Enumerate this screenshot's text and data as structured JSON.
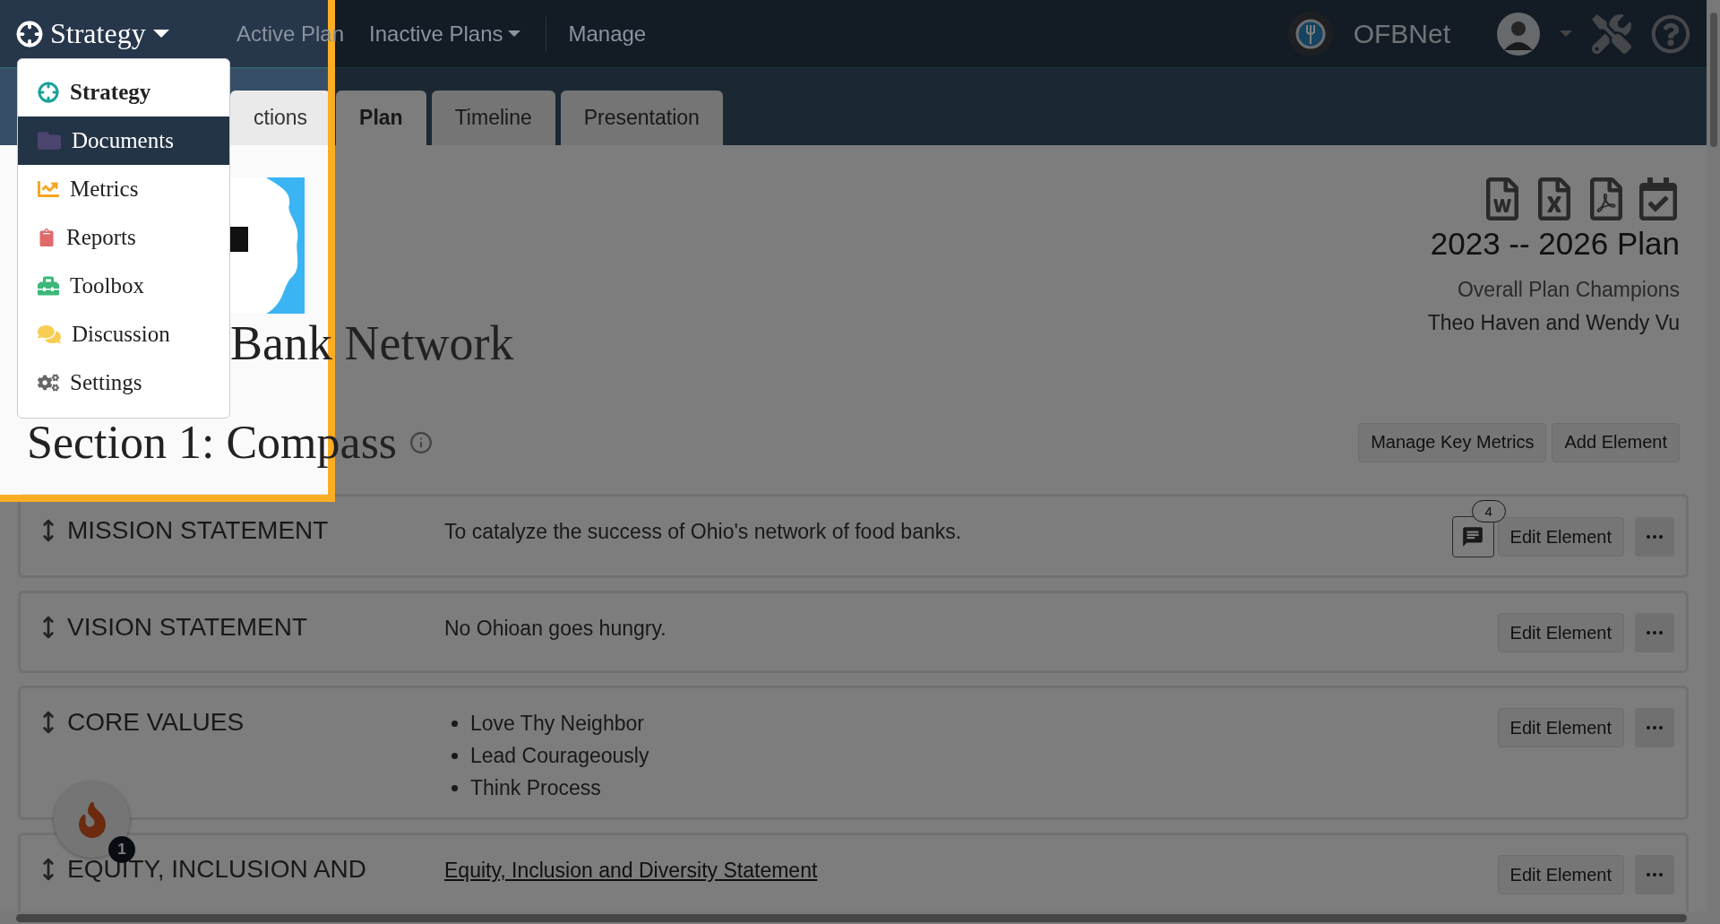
{
  "navbar": {
    "brand": "Strategy",
    "links": [
      {
        "label": "Active Plan",
        "dropdown": false
      },
      {
        "label": "Inactive Plans",
        "dropdown": true
      },
      {
        "label": "Manage",
        "dropdown": false
      }
    ],
    "org": "OFBNet"
  },
  "brand_menu": {
    "items": [
      {
        "label": "Strategy",
        "kind": "header",
        "selected": false
      },
      {
        "label": "Documents",
        "kind": "link",
        "selected": true
      },
      {
        "label": "Metrics",
        "kind": "link",
        "selected": false
      },
      {
        "label": "Reports",
        "kind": "link",
        "selected": false
      },
      {
        "label": "Toolbox",
        "kind": "link",
        "selected": false
      },
      {
        "label": "Discussion",
        "kind": "link",
        "selected": false
      },
      {
        "label": "Settings",
        "kind": "link",
        "selected": false
      }
    ]
  },
  "tabs": [
    {
      "label": "ctions",
      "selected": false
    },
    {
      "label": "Plan",
      "selected": true
    },
    {
      "label": "Timeline",
      "selected": false
    },
    {
      "label": "Presentation",
      "selected": false
    }
  ],
  "plan": {
    "title": "Bank Network",
    "period": "2023 -- 2026 Plan",
    "champions_label": "Overall Plan Champions",
    "champions": "Theo Haven and Wendy Vu"
  },
  "section": {
    "title": "Section 1: Compass",
    "buttons": [
      "Manage Key Metrics",
      "Add Element"
    ]
  },
  "elements": [
    {
      "title": "MISSION STATEMENT",
      "kind": "text",
      "content": "To catalyze the success of Ohio's network of food banks.",
      "comments": "4",
      "edit": "Edit Element"
    },
    {
      "title": "VISION STATEMENT",
      "kind": "text",
      "content": "No Ohioan goes hungry.",
      "edit": "Edit Element"
    },
    {
      "title": "CORE VALUES",
      "kind": "list",
      "items": [
        "Love Thy Neighbor",
        "Lead Courageously",
        "Think Process"
      ],
      "edit": "Edit Element"
    },
    {
      "title": "EQUITY, INCLUSION AND",
      "kind": "link",
      "content": "Equity, Inclusion and Diversity Statement",
      "edit": "Edit Element"
    }
  ],
  "notifications": {
    "count": "1"
  },
  "tour": {
    "highlight": true
  }
}
